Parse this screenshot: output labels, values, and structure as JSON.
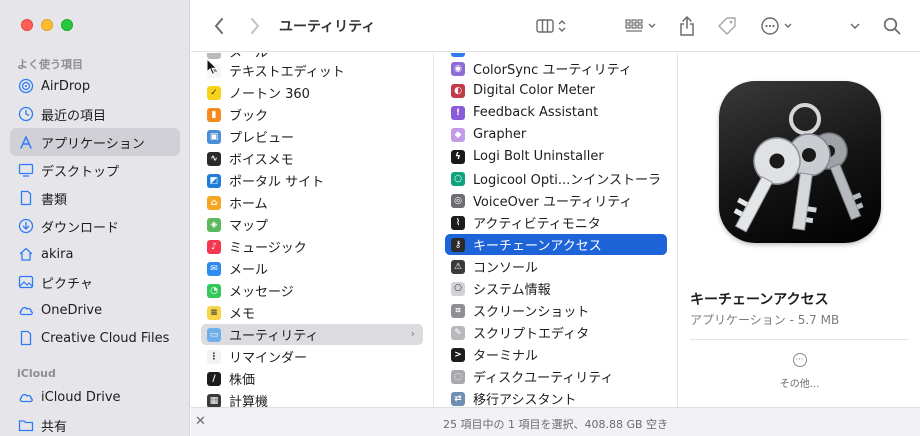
{
  "sidebar": {
    "favorites_header": "よく使う項目",
    "favorites": [
      {
        "label": "AirDrop",
        "icon": "airdrop-icon"
      },
      {
        "label": "最近の項目",
        "icon": "clock-icon"
      },
      {
        "label": "アプリケーション",
        "icon": "apps-icon",
        "selected": true
      },
      {
        "label": "デスクトップ",
        "icon": "desktop-icon"
      },
      {
        "label": "書類",
        "icon": "document-icon"
      },
      {
        "label": "ダウンロード",
        "icon": "download-icon"
      },
      {
        "label": "akira",
        "icon": "home-icon"
      },
      {
        "label": "ピクチャ",
        "icon": "photo-icon"
      },
      {
        "label": "OneDrive",
        "icon": "cloud-icon"
      },
      {
        "label": "Creative Cloud Files",
        "icon": "file-icon"
      }
    ],
    "icloud_header": "iCloud",
    "icloud": [
      {
        "label": "iCloud Drive",
        "icon": "cloud-icon"
      },
      {
        "label": "共有",
        "icon": "shared-folder-icon"
      }
    ]
  },
  "toolbar": {
    "title": "ユーティリティ"
  },
  "column1": {
    "items": [
      {
        "label": "テキストエディット",
        "color": "#f5f5f5",
        "glyph": "✎"
      },
      {
        "label": "ノートン 360",
        "color": "#f8d31a",
        "glyph": "✓"
      },
      {
        "label": "ブック",
        "color": "#f58b1f",
        "glyph": "▮"
      },
      {
        "label": "プレビュー",
        "color": "#4a8fd6",
        "glyph": "▣"
      },
      {
        "label": "ボイスメモ",
        "color": "#2b2b2b",
        "glyph": "∿"
      },
      {
        "label": "ポータル サイト",
        "color": "#1f7fd8",
        "glyph": "◩"
      },
      {
        "label": "ホーム",
        "color": "#f5a623",
        "glyph": "⌂"
      },
      {
        "label": "マップ",
        "color": "#5cb85c",
        "glyph": "◈"
      },
      {
        "label": "ミュージック",
        "color": "#f5374f",
        "glyph": "♪"
      },
      {
        "label": "メール",
        "color": "#2e8cf0",
        "glyph": "✉"
      },
      {
        "label": "メッセージ",
        "color": "#34c759",
        "glyph": "◔"
      },
      {
        "label": "メモ",
        "color": "#f7d54a",
        "glyph": "≡"
      },
      {
        "label": "ユーティリティ",
        "color": "#6fb0ea",
        "glyph": "▭",
        "folder": true
      },
      {
        "label": "リマインダー",
        "color": "#f2f2f2",
        "glyph": "⋮"
      },
      {
        "label": "株価",
        "color": "#1c1c1e",
        "glyph": "∕"
      },
      {
        "label": "計算機",
        "color": "#3a3a3c",
        "glyph": "▦"
      }
    ],
    "partial_top": "メール"
  },
  "column2": {
    "items": [
      {
        "label": "ColorSync ユーティリティ",
        "color": "#8e6cd6",
        "glyph": "◉"
      },
      {
        "label": "Digital Color Meter",
        "color": "#c23b4a",
        "glyph": "◐"
      },
      {
        "label": "Feedback Assistant",
        "color": "#8a5cd9",
        "glyph": "!"
      },
      {
        "label": "Grapher",
        "color": "#c49be6",
        "glyph": "◆"
      },
      {
        "label": "Logi Bolt Uninstaller",
        "color": "#1a1a1a",
        "glyph": "ϟ"
      },
      {
        "label": "Logicool Opti...ンインストーラ",
        "color": "#0fa37f",
        "glyph": "○"
      },
      {
        "label": "VoiceOver ユーティリティ",
        "color": "#6d6d72",
        "glyph": "◎"
      },
      {
        "label": "アクティビティモニタ",
        "color": "#1c1c1e",
        "glyph": "⌇"
      },
      {
        "label": "キーチェーンアクセス",
        "color": "#2a2a2c",
        "glyph": "⚷"
      },
      {
        "label": "コンソール",
        "color": "#3a3a3c",
        "glyph": "⚠"
      },
      {
        "label": "システム情報",
        "color": "#d1d1d6",
        "glyph": "⎔"
      },
      {
        "label": "スクリーンショット",
        "color": "#8e8e93",
        "glyph": "⌗"
      },
      {
        "label": "スクリプトエディタ",
        "color": "#b8b8bd",
        "glyph": "✎"
      },
      {
        "label": "ターミナル",
        "color": "#1c1c1e",
        "glyph": ">"
      },
      {
        "label": "ディスクユーティリティ",
        "color": "#a9a9ae",
        "glyph": "◌"
      },
      {
        "label": "移行アシスタント",
        "color": "#6f8fb0",
        "glyph": "⇄"
      }
    ]
  },
  "preview": {
    "name": "キーチェーンアクセス",
    "kind_size": "アプリケーション - 5.7 MB",
    "more": "その他..."
  },
  "status": {
    "text": "25 項目中の 1 項目を選択、408.88 GB 空き"
  },
  "colors": {
    "selection_blue": "#1d64d8",
    "sidebar_accent": "#2f7bf6"
  }
}
